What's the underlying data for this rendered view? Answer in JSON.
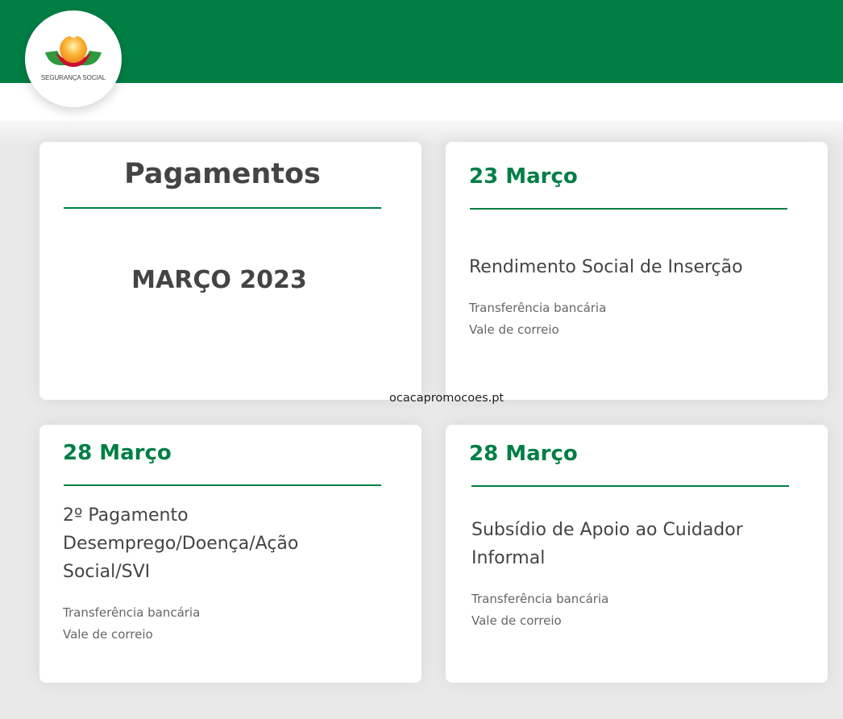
{
  "header": {
    "logo_text": "SEGURANÇA SOCIAL",
    "brand_color": "#007f45"
  },
  "summary_card": {
    "title": "Pagamentos",
    "period": "MARÇO 2023"
  },
  "payments": [
    {
      "date": "23 Março",
      "benefit": "Rendimento Social de Inserção",
      "methods": [
        "Transferência bancária",
        "Vale de correio"
      ]
    },
    {
      "date": "28 Março",
      "benefit": "2º Pagamento Desemprego/Doença/Ação Social/SVI",
      "methods": [
        "Transferência bancária",
        "Vale de correio"
      ]
    },
    {
      "date": "28 Março",
      "benefit": "Subsídio de Apoio ao Cuidador Informal",
      "methods": [
        "Transferência bancária",
        "Vale de correio"
      ]
    }
  ],
  "watermark": "ocacapromocoes.pt"
}
